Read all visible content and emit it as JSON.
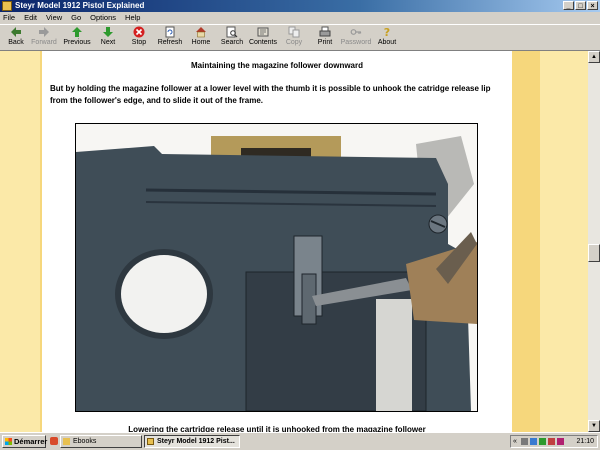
{
  "window": {
    "title": "Steyr Model 1912 Pistol Explained",
    "controls": [
      "_",
      "□",
      "×"
    ]
  },
  "menu": [
    "File",
    "Edit",
    "View",
    "Go",
    "Options",
    "Help"
  ],
  "toolbar": {
    "back": "Back",
    "forward": "Forward",
    "previous": "Previous",
    "next": "Next",
    "stop": "Stop",
    "refresh": "Refresh",
    "home": "Home",
    "search": "Search",
    "contents": "Contents",
    "copy": "Copy",
    "print": "Print",
    "password": "Password",
    "about": "About"
  },
  "page": {
    "heading": "Maintaining the magazine follower downward",
    "paragraph": "But by holding the magazine follower at a lower level with the thumb it is possible to unhook the catridge release lip from the follower's edge, and to slide it out of the frame.",
    "caption": "Lowering the cartridge release until it is unhooked from the magazine follower"
  },
  "taskbar": {
    "start": "Démarrer",
    "tasks": [
      "Ebooks",
      "Steyr Model 1912 Pist..."
    ],
    "clock": "21:10",
    "tray_marker": "«"
  },
  "colors": {
    "title_bar": "#0a246a",
    "side_band": "#fbe9a8",
    "side_strip": "#f6d77c",
    "pistol": "#3f4d57"
  }
}
